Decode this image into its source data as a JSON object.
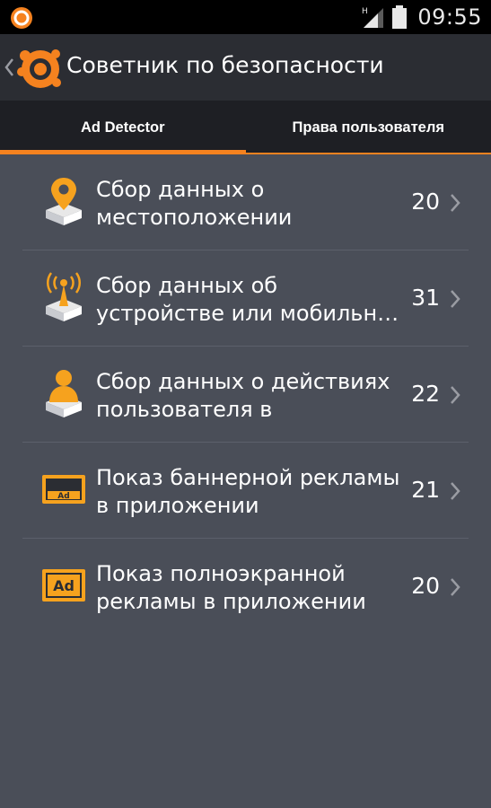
{
  "status_bar": {
    "time": "09:55",
    "network_type": "H"
  },
  "action_bar": {
    "title": "Советник по безопасности"
  },
  "tabs": [
    {
      "label": "Ad Detector",
      "active": true
    },
    {
      "label": "Права пользователя",
      "active": false
    }
  ],
  "items": [
    {
      "line1": "Сбор данных о",
      "line2": "местоположении",
      "count": "20",
      "icon": "location-pin-icon"
    },
    {
      "line1": "Сбор данных об",
      "line2": "устройстве или мобильн…",
      "count": "31",
      "icon": "antenna-icon"
    },
    {
      "line1": "Сбор данных о действиях",
      "line2": "пользователя в",
      "count": "22",
      "icon": "user-icon"
    },
    {
      "line1": "Показ баннерной рекламы",
      "line2": "в приложении",
      "count": "21",
      "icon": "banner-ad-icon",
      "icon_text": "Ad"
    },
    {
      "line1": "Показ полноэкранной",
      "line2": "рекламы в приложении",
      "count": "20",
      "icon": "fullscreen-ad-icon",
      "icon_text": "Ad"
    }
  ],
  "colors": {
    "accent": "#f5821f",
    "background": "#4a4e58",
    "action_bar": "#2b2d33",
    "tab_bar": "#1e1f24"
  }
}
